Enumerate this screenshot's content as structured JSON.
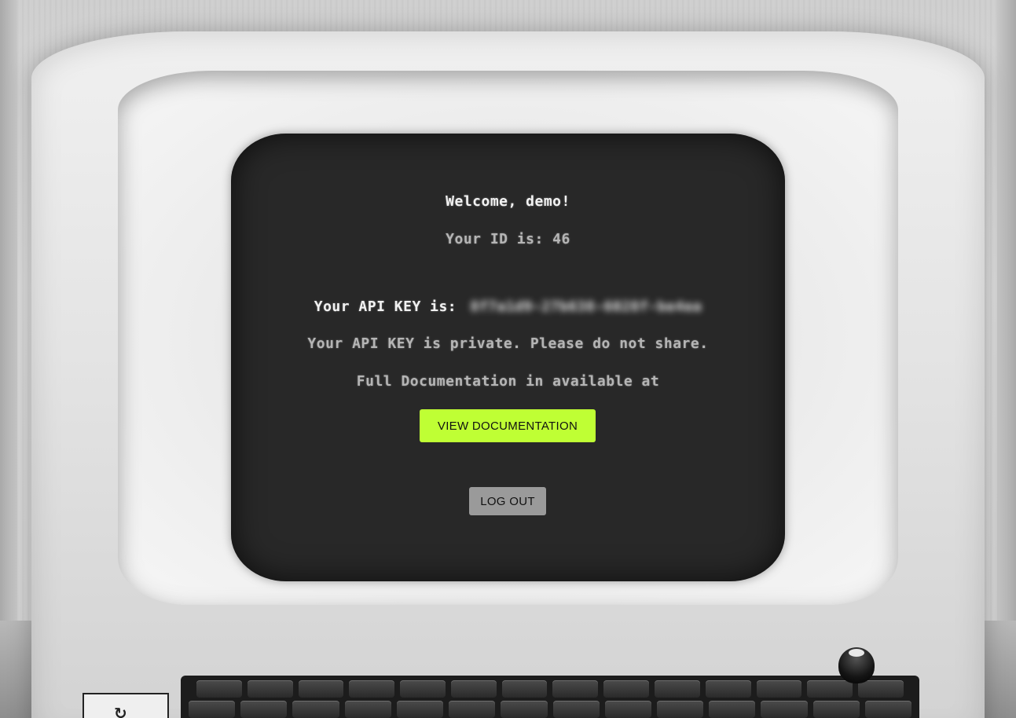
{
  "screen": {
    "welcome": "Welcome, demo!",
    "user_id_line": "Your ID is: 46",
    "api_key_label": "Your API KEY is:",
    "api_key_value": "8f7a1d9-27b638-6028f-be4ea",
    "private_note": "Your API KEY is private. Please do not share.",
    "docs_note": "Full Documentation in available at"
  },
  "actions": {
    "view_docs_label": "VIEW DOCUMENTATION",
    "logout_label": "LOG OUT"
  },
  "colors": {
    "screen_bg": "#282828",
    "accent_button": "#bfff34",
    "secondary_button": "#9a9a9a"
  }
}
